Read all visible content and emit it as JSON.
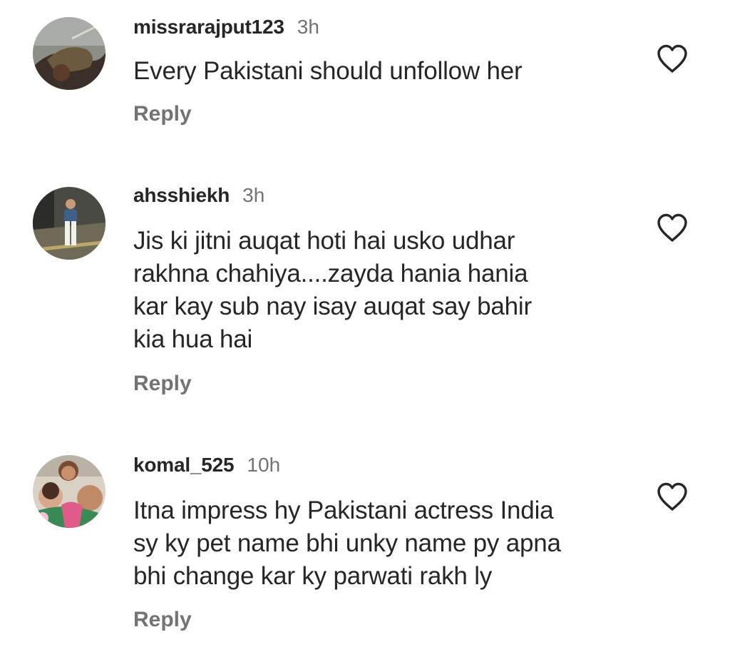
{
  "comments": [
    {
      "username": "missrarajput123",
      "time": "3h",
      "text": "Every Pakistani should unfollow her",
      "reply_label": "Reply"
    },
    {
      "username": "ahsshiekh",
      "time": "3h",
      "text_lines": [
        "Jis ki jitni auqat hoti hai usko udhar",
        "rakhna chahiya....zayda hania hania",
        "kar kay sub nay isay auqat say bahir",
        "kia hua hai"
      ],
      "reply_label": "Reply"
    },
    {
      "username": "komal_525",
      "time": "10h",
      "text_lines": [
        "Itna impress hy Pakistani actress India",
        "sy ky pet name bhi unky name py apna",
        "bhi change kar ky parwati rakh ly"
      ],
      "reply_label": "Reply"
    }
  ],
  "icons": {
    "like": "heart-outline-icon"
  },
  "colors": {
    "text": "#262626",
    "secondary": "#737373"
  }
}
